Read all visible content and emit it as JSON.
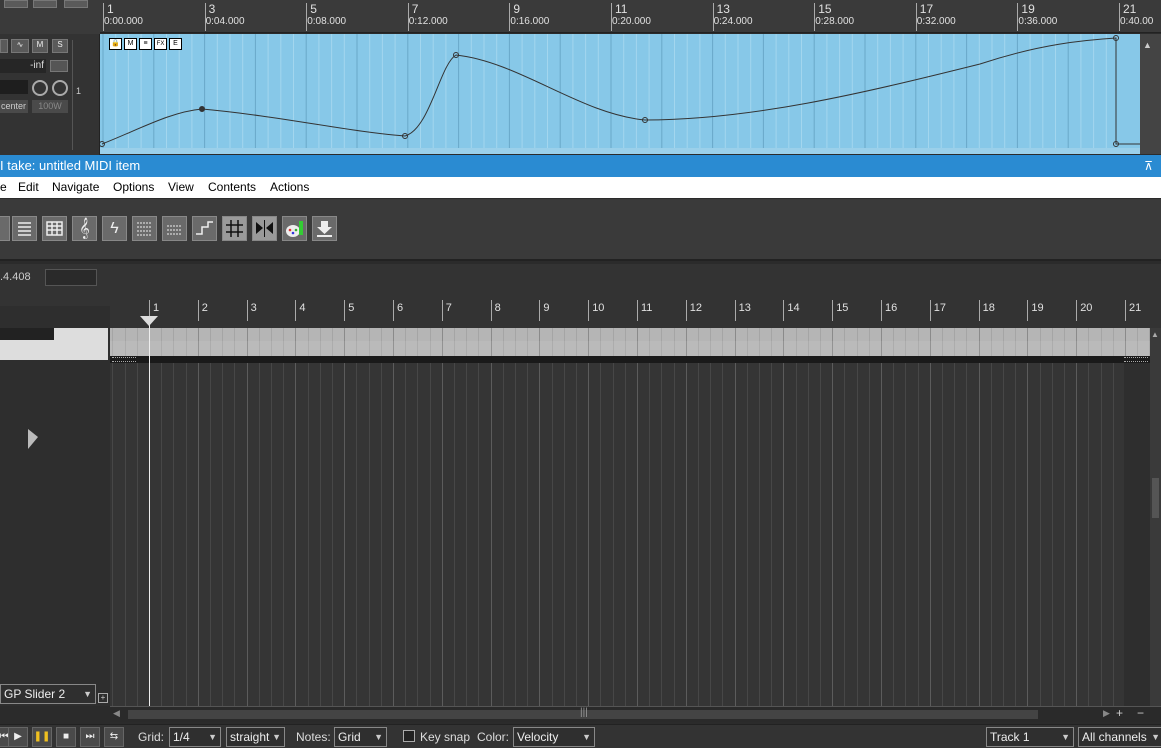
{
  "track_panel": {
    "buttons": [
      "M",
      "S"
    ],
    "volume": "-inf",
    "pan": "center",
    "width": "100W",
    "track_number": "1"
  },
  "top_ruler": {
    "marks": [
      {
        "num": "1",
        "time": "0:00.000"
      },
      {
        "num": "3",
        "time": "0:04.000"
      },
      {
        "num": "5",
        "time": "0:08.000"
      },
      {
        "num": "7",
        "time": "0:12.000"
      },
      {
        "num": "9",
        "time": "0:16.000"
      },
      {
        "num": "11",
        "time": "0:20.000"
      },
      {
        "num": "13",
        "time": "0:24.000"
      },
      {
        "num": "15",
        "time": "0:28.000"
      },
      {
        "num": "17",
        "time": "0:32.000"
      },
      {
        "num": "19",
        "time": "0:36.000"
      },
      {
        "num": "21",
        "time": "0:40.00"
      }
    ]
  },
  "item": {
    "buttons": [
      "🔒",
      "M",
      "≡",
      "FX",
      "E"
    ]
  },
  "window": {
    "title": "I take: untitled MIDI item",
    "close_glyph": "⊼"
  },
  "menu": [
    "e",
    "Edit",
    "Navigate",
    "Options",
    "View",
    "Contents",
    "Actions"
  ],
  "position": {
    "value": ".4.408",
    "field": ""
  },
  "midi_ruler": {
    "marks": [
      "1",
      "2",
      "3",
      "4",
      "5",
      "6",
      "7",
      "8",
      "9",
      "10",
      "11",
      "12",
      "13",
      "14",
      "15",
      "16",
      "17",
      "18",
      "19",
      "20",
      "21"
    ]
  },
  "lane": {
    "cc_name": "GP Slider 2"
  },
  "status": {
    "grid_label": "Grid:",
    "grid_value": "1/4",
    "grid_type": "straight",
    "notes_label": "Notes:",
    "notes_value": "Grid",
    "keysnap_label": "Key snap",
    "color_label": "Color:",
    "color_value": "Velocity",
    "track_value": "Track 1",
    "channels_value": "All channels"
  }
}
